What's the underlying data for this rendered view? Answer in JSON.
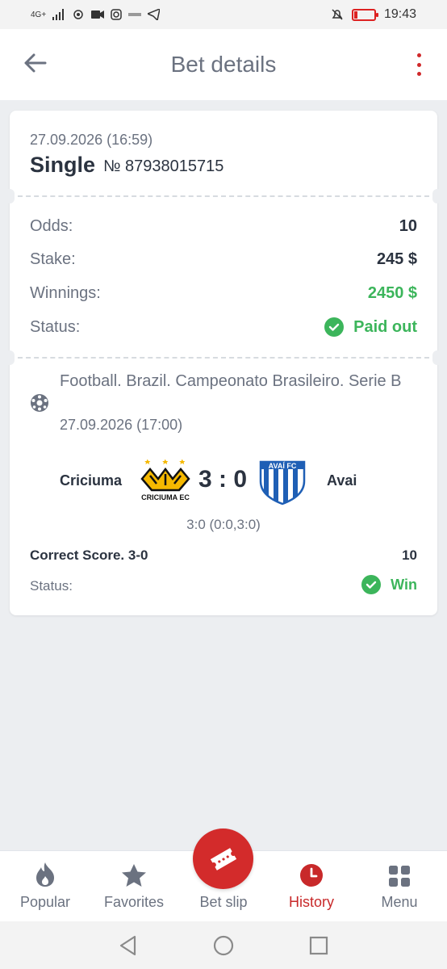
{
  "status_bar": {
    "network": "4G+",
    "time": "19:43"
  },
  "header": {
    "title": "Bet details"
  },
  "bet": {
    "datetime": "27.09.2026 (16:59)",
    "type": "Single",
    "number": "№ 87938015715",
    "summary": [
      {
        "label": "Odds:",
        "value": "10"
      },
      {
        "label": "Stake:",
        "value": "245 $"
      },
      {
        "label": "Winnings:",
        "value": "2450 $"
      }
    ],
    "status_label": "Status:",
    "status_value": "Paid out"
  },
  "event": {
    "league": "Football. Brazil. Campeonato Brasileiro. Serie B",
    "datetime": "27.09.2026 (17:00)",
    "home_team": "Criciuma",
    "away_team": "Avai",
    "home_logo_text": "CRICIUMA EC",
    "away_logo_text": "AVAÍ FC",
    "score": "3 : 0",
    "score_detail": "3:0 (0:0,3:0)",
    "market": "Correct Score. 3-0",
    "market_odds": "10",
    "status_label": "Status:",
    "status_value": "Win"
  },
  "bottom_nav": {
    "items": [
      {
        "label": "Popular",
        "icon": "flame-icon"
      },
      {
        "label": "Favorites",
        "icon": "star-icon"
      },
      {
        "label": "Bet slip",
        "icon": "ticket-icon"
      },
      {
        "label": "History",
        "icon": "clock-icon"
      },
      {
        "label": "Menu",
        "icon": "grid-icon"
      }
    ]
  },
  "colors": {
    "accent_red": "#d32b2b",
    "success_green": "#3cb55b",
    "text_dark": "#2b3340",
    "text_muted": "#6b7280"
  }
}
